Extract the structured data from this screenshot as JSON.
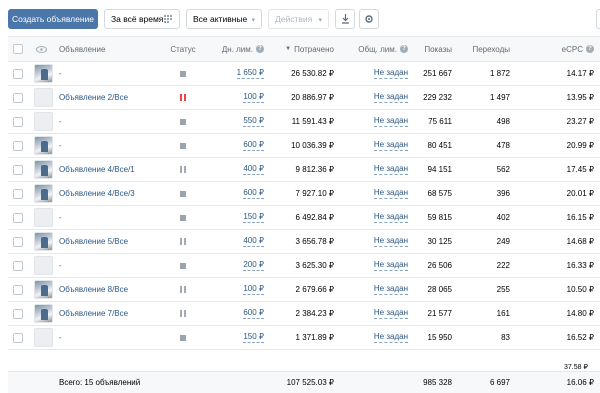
{
  "toolbar": {
    "create_label": "Создать объявление",
    "period_label": "За всё время",
    "filter_label": "Все активные",
    "actions_label": "Действия"
  },
  "columns": {
    "ad": "Объявление",
    "status": "Статус",
    "daily_limit": "Дн. лим.",
    "spent": "Потрачено",
    "total_limit": "Общ. лим.",
    "views": "Показы",
    "clicks": "Переходы",
    "ecpc": "eCPC"
  },
  "rows": [
    {
      "name": "-",
      "thumb": "photo",
      "status": "active",
      "daily": "1 650 ₽",
      "spent": "26 530.82 ₽",
      "total": "Не задан",
      "views": "251 667",
      "clicks": "1 872",
      "ecpc": "14.17 ₽"
    },
    {
      "name": "Объявление 2/Все",
      "thumb": "blank",
      "status": "paused-red",
      "daily": "100 ₽",
      "spent": "20 886.97 ₽",
      "total": "Не задан",
      "views": "229 232",
      "clicks": "1 497",
      "ecpc": "13.95 ₽"
    },
    {
      "name": "-",
      "thumb": "blank",
      "status": "active",
      "daily": "550 ₽",
      "spent": "11 591.43 ₽",
      "total": "Не задан",
      "views": "75 611",
      "clicks": "498",
      "ecpc": "23.27 ₽"
    },
    {
      "name": "-",
      "thumb": "photo",
      "status": "active",
      "daily": "600 ₽",
      "spent": "10 036.39 ₽",
      "total": "Не задан",
      "views": "80 451",
      "clicks": "478",
      "ecpc": "20.99 ₽"
    },
    {
      "name": "Объявление 4/Все/1",
      "thumb": "photo",
      "status": "paused",
      "daily": "400 ₽",
      "spent": "9 812.36 ₽",
      "total": "Не задан",
      "views": "94 151",
      "clicks": "562",
      "ecpc": "17.45 ₽"
    },
    {
      "name": "Объявление 4/Все/3",
      "thumb": "photo",
      "status": "active",
      "daily": "600 ₽",
      "spent": "7 927.10 ₽",
      "total": "Не задан",
      "views": "68 575",
      "clicks": "396",
      "ecpc": "20.01 ₽"
    },
    {
      "name": "-",
      "thumb": "blank",
      "status": "active",
      "daily": "150 ₽",
      "spent": "6 492.84 ₽",
      "total": "Не задан",
      "views": "59 815",
      "clicks": "402",
      "ecpc": "16.15 ₽"
    },
    {
      "name": "Объявление 5/Все",
      "thumb": "photo",
      "status": "paused",
      "daily": "400 ₽",
      "spent": "3 656.78 ₽",
      "total": "Не задан",
      "views": "30 125",
      "clicks": "249",
      "ecpc": "14.68 ₽"
    },
    {
      "name": "-",
      "thumb": "blank",
      "status": "active",
      "daily": "200 ₽",
      "spent": "3 625.30 ₽",
      "total": "Не задан",
      "views": "26 506",
      "clicks": "222",
      "ecpc": "16.33 ₽"
    },
    {
      "name": "Объявление 8/Все",
      "thumb": "photo",
      "status": "paused",
      "daily": "100 ₽",
      "spent": "2 679.66 ₽",
      "total": "Не задан",
      "views": "28 065",
      "clicks": "255",
      "ecpc": "10.50 ₽"
    },
    {
      "name": "Объявление 7/Все",
      "thumb": "photo",
      "status": "paused",
      "daily": "600 ₽",
      "spent": "2 384.23 ₽",
      "total": "Не задан",
      "views": "21 577",
      "clicks": "161",
      "ecpc": "14.80 ₽"
    },
    {
      "name": "-",
      "thumb": "blank",
      "status": "active",
      "daily": "150 ₽",
      "spent": "1 371.89 ₽",
      "total": "Не задан",
      "views": "15 950",
      "clicks": "83",
      "ecpc": "16.52 ₽"
    }
  ],
  "partial_next_ecpc": "37.58 ₽",
  "footer": {
    "total_label": "Всего: 15 объявлений",
    "spent": "107 525.03 ₽",
    "views": "985 328",
    "clicks": "6 697",
    "ecpc": "16.06 ₽"
  }
}
